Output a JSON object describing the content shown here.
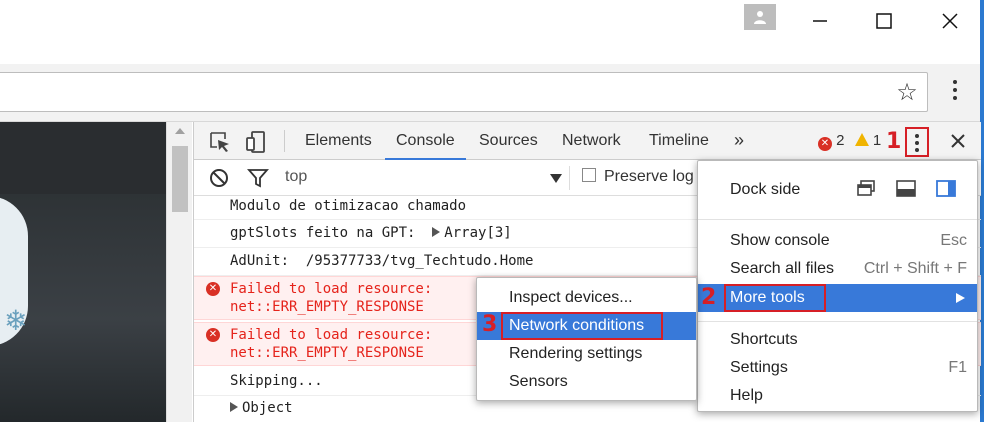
{
  "window": {
    "minimize_icon": "minimize-icon",
    "maximize_icon": "maximize-icon",
    "close_icon": "close-icon",
    "profile_icon": "person-icon"
  },
  "toolbar": {
    "bookmark_icon": "star-icon",
    "menu_icon": "vertical-dots-icon"
  },
  "devtools": {
    "tabs": [
      {
        "label": "Elements",
        "active": false
      },
      {
        "label": "Console",
        "active": true
      },
      {
        "label": "Sources",
        "active": false
      },
      {
        "label": "Network",
        "active": false
      },
      {
        "label": "Timeline",
        "active": false
      }
    ],
    "more_tabs": "»",
    "error_count": "2",
    "warning_count": "1",
    "filter": {
      "context": "top",
      "preserve_log_label": "Preserve log",
      "preserve_log_checked": false
    }
  },
  "console": {
    "rows": [
      {
        "text": "Modulo de otimizacao chamado",
        "type": "log"
      },
      {
        "text": "gptSlots feito na GPT:  ",
        "expand": "Array[3]",
        "type": "log"
      },
      {
        "text": "AdUnit:  /95377733/tvg_Techtudo.Home",
        "type": "log"
      },
      {
        "line1": "Failed to load resource:",
        "line2": "net::ERR_EMPTY_RESPONSE",
        "type": "error"
      },
      {
        "line1": "Failed to load resource:",
        "line2": "net::ERR_EMPTY_RESPONSE",
        "type": "error"
      },
      {
        "text": "Skipping...",
        "type": "log"
      },
      {
        "expand": "Object",
        "type": "log"
      }
    ]
  },
  "main_menu": {
    "dock_side_label": "Dock side",
    "items": [
      {
        "label": "Show console",
        "shortcut": "Esc"
      },
      {
        "label": "Search all files",
        "shortcut": "Ctrl + Shift + F"
      },
      {
        "label": "More tools",
        "shortcut": "",
        "submenu": true,
        "highlighted": true
      },
      {
        "label": "Shortcuts",
        "shortcut": ""
      },
      {
        "label": "Settings",
        "shortcut": "F1"
      },
      {
        "label": "Help",
        "shortcut": ""
      }
    ]
  },
  "more_tools_menu": {
    "items": [
      {
        "label": "Inspect devices...",
        "highlighted": false
      },
      {
        "label": "Network conditions",
        "highlighted": true
      },
      {
        "label": "Rendering settings",
        "highlighted": false
      },
      {
        "label": "Sensors",
        "highlighted": false
      }
    ]
  },
  "steps": {
    "one": "1",
    "two": "2",
    "three": "3"
  },
  "colors": {
    "accent": "#3879d9",
    "annotation_red": "#d61f26",
    "error_text": "#e5231b",
    "error_bg": "#fff0f0",
    "window_border": "#2b79d0"
  }
}
